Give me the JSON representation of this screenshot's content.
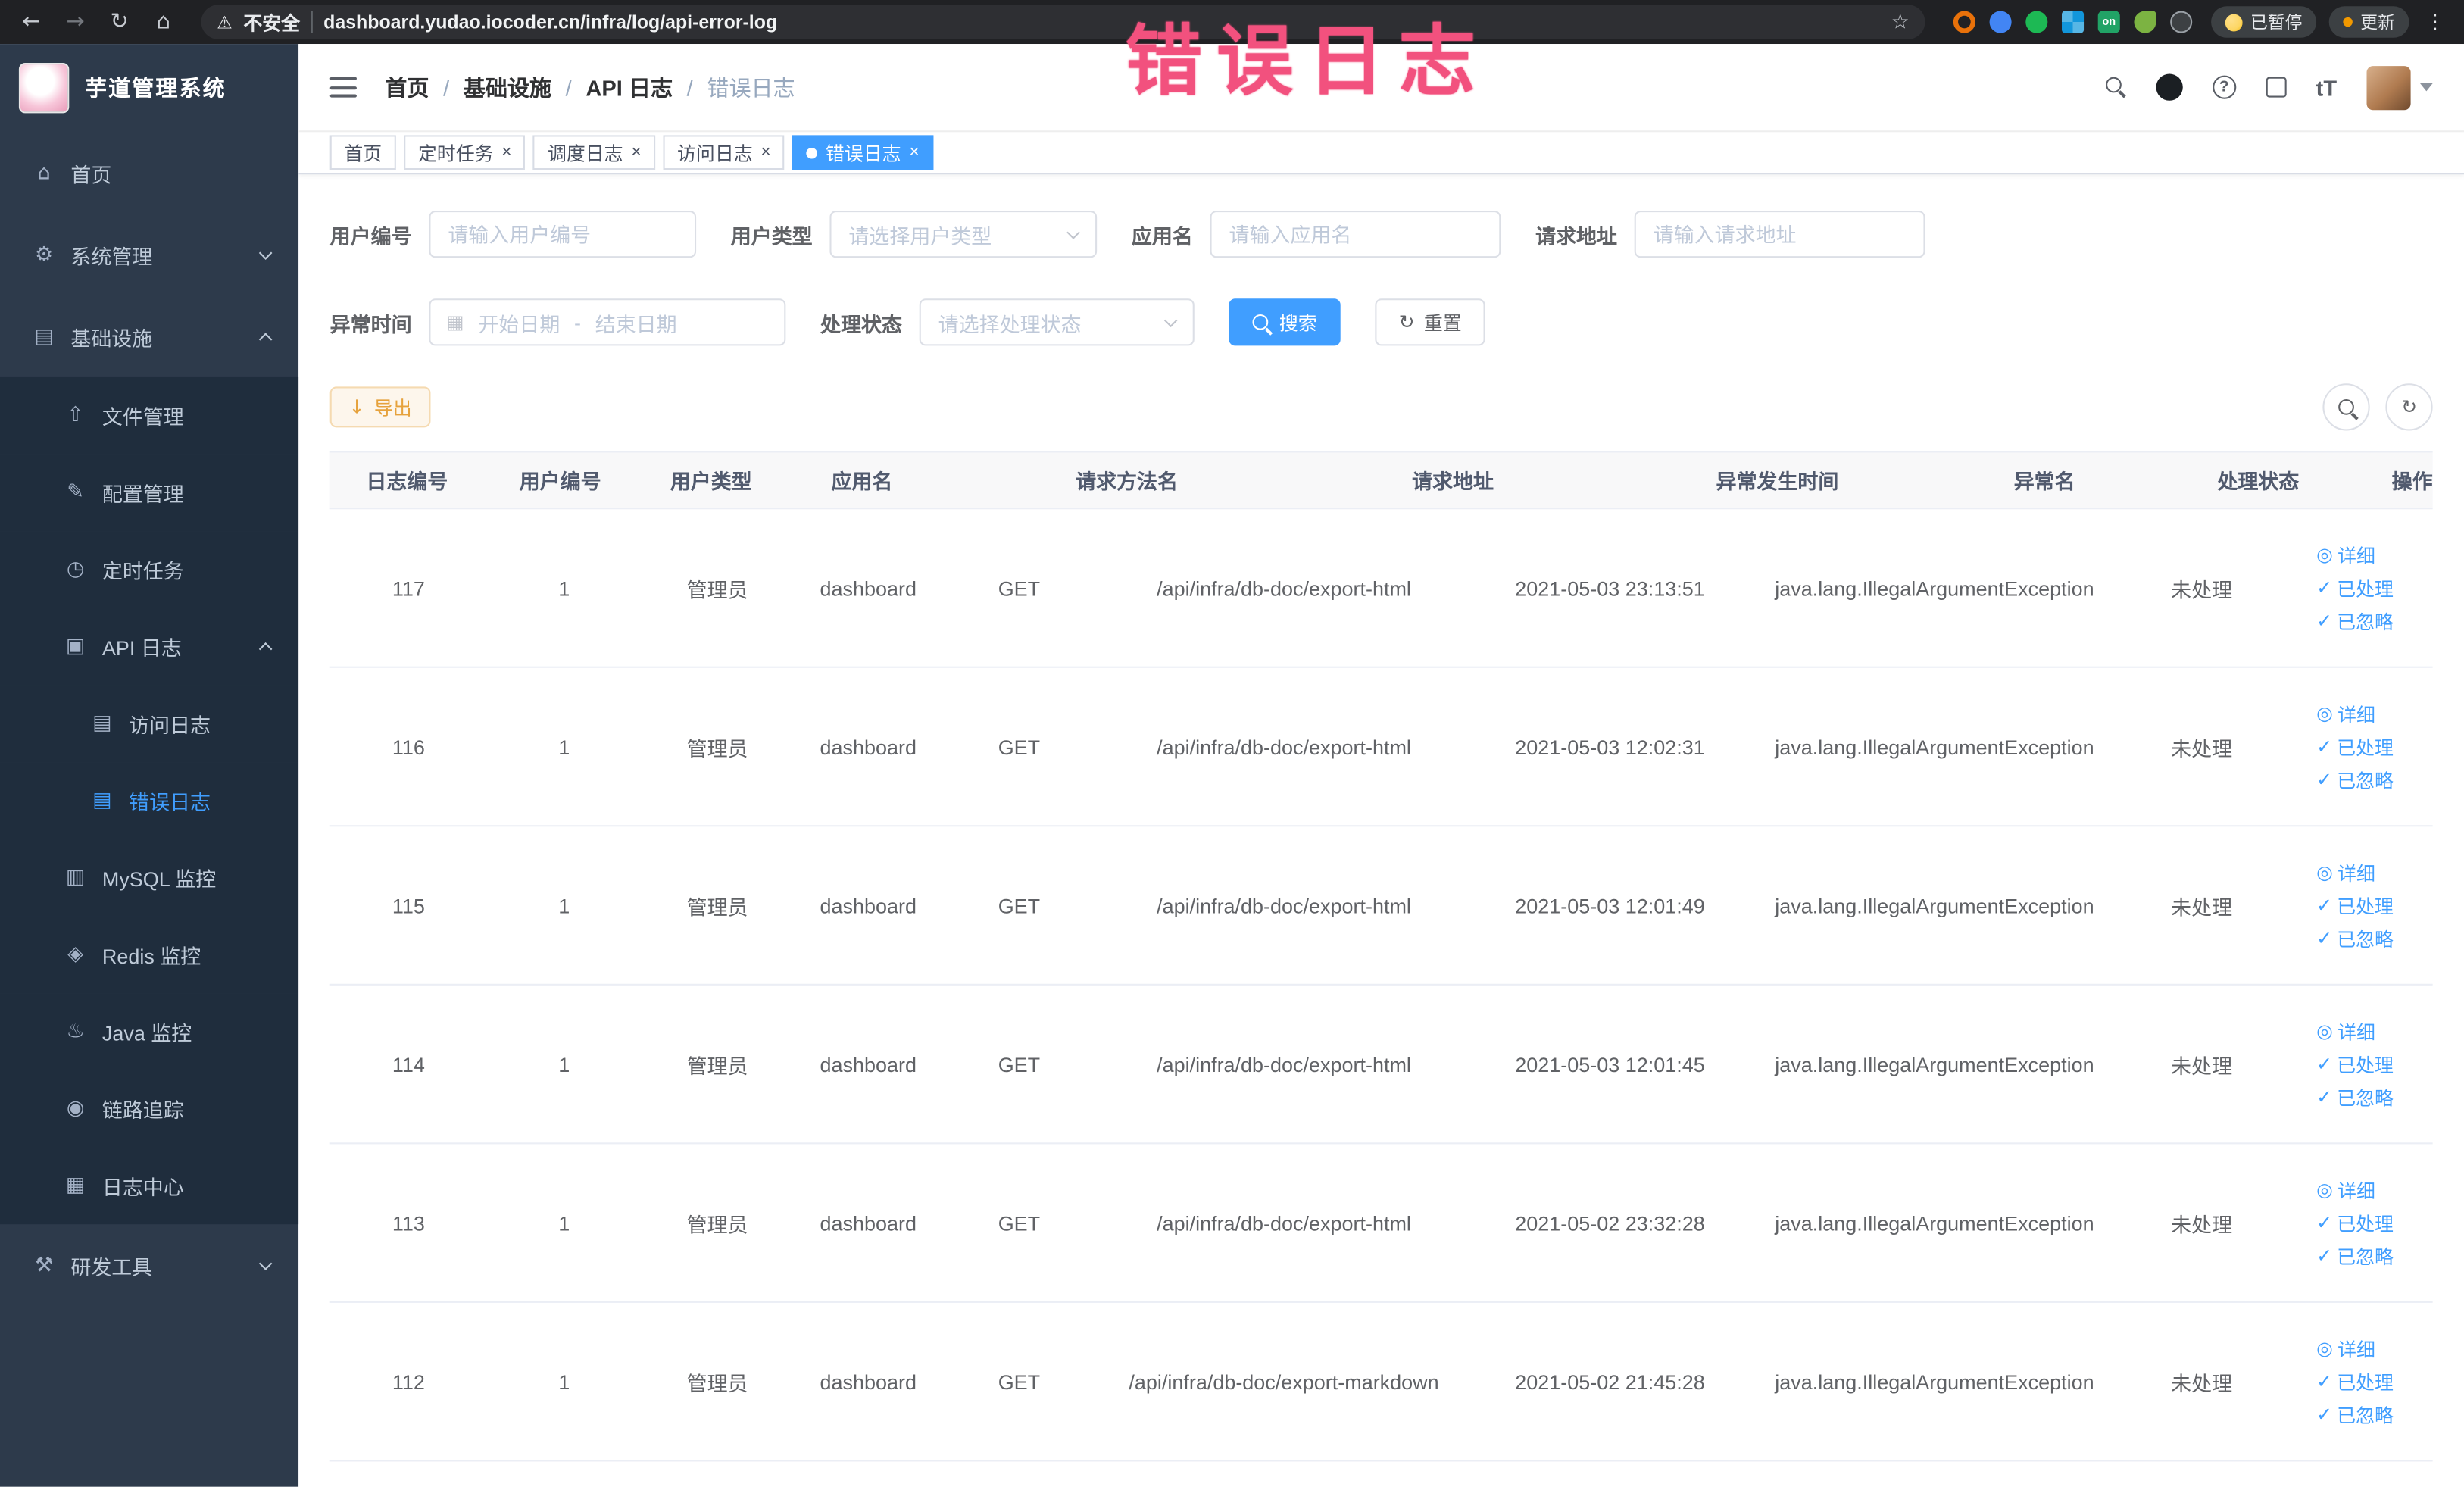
{
  "colors": {
    "accent": "#409EFF",
    "watermark": "#F2517E",
    "warning": "#E6A23C",
    "sidebar_bg": "#2D3A4B",
    "submenu_bg": "#1F2D3D",
    "browser_bar_bg": "#202124"
  },
  "browser": {
    "security_text": "不安全",
    "url": "dashboard.yudao.iocoder.cn/infra/log/api-error-log",
    "paused_label": "已暂停",
    "update_label": "更新",
    "ext_on_label": "on"
  },
  "watermark_text": "错误日志",
  "icons": {
    "back": "←",
    "forward": "→",
    "reload": "↻",
    "home": "⌂",
    "warning": "⚠",
    "star": "☆",
    "dots": "⋮",
    "question": "?",
    "font_size": "tT",
    "calendar": "▦",
    "download": "↓",
    "refresh": "↻",
    "detail": "◎",
    "check": "✓",
    "close": "×"
  },
  "sidebar": {
    "logo_title": "芋道管理系统",
    "items": [
      {
        "label": "首页",
        "icon": "home-icon",
        "glyph": "⌂",
        "level": 1
      },
      {
        "label": "系统管理",
        "icon": "gear-icon",
        "glyph": "⚙",
        "level": 1,
        "arrow": "down"
      },
      {
        "label": "基础设施",
        "icon": "infrastructure-icon",
        "glyph": "▤",
        "level": 1,
        "arrow": "up"
      },
      {
        "label": "文件管理",
        "icon": "file-management-icon",
        "glyph": "⇧",
        "level": 2
      },
      {
        "label": "配置管理",
        "icon": "config-management-icon",
        "glyph": "✎",
        "level": 2
      },
      {
        "label": "定时任务",
        "icon": "scheduled-task-icon",
        "glyph": "◷",
        "level": 2
      },
      {
        "label": "API 日志",
        "icon": "api-log-icon",
        "glyph": "▣",
        "level": 2,
        "arrow": "up"
      },
      {
        "label": "访问日志",
        "icon": "access-log-icon",
        "glyph": "▤",
        "level": 3
      },
      {
        "label": "错误日志",
        "icon": "error-log-icon",
        "glyph": "▤",
        "level": 3,
        "active": "true"
      },
      {
        "label": "MySQL 监控",
        "icon": "mysql-monitor-icon",
        "glyph": "▥",
        "level": 2
      },
      {
        "label": "Redis 监控",
        "icon": "redis-monitor-icon",
        "glyph": "◈",
        "level": 2
      },
      {
        "label": "Java 监控",
        "icon": "java-monitor-icon",
        "glyph": "♨",
        "level": 2
      },
      {
        "label": "链路追踪",
        "icon": "trace-icon",
        "glyph": "◉",
        "level": 2
      },
      {
        "label": "日志中心",
        "icon": "log-center-icon",
        "glyph": "▦",
        "level": 2
      },
      {
        "label": "研发工具",
        "icon": "dev-tools-icon",
        "glyph": "⚒",
        "level": 1,
        "arrow": "down"
      }
    ]
  },
  "header": {
    "breadcrumb": [
      "首页",
      "基础设施",
      "API 日志",
      "错误日志"
    ],
    "separator": "/"
  },
  "tabs": [
    {
      "label": "首页",
      "closable": "false",
      "active": "false"
    },
    {
      "label": "定时任务",
      "closable": "true",
      "active": "false"
    },
    {
      "label": "调度日志",
      "closable": "true",
      "active": "false"
    },
    {
      "label": "访问日志",
      "closable": "true",
      "active": "false"
    },
    {
      "label": "错误日志",
      "closable": "true",
      "active": "true"
    }
  ],
  "filters": {
    "user_id_label": "用户编号",
    "user_id_placeholder": "请输入用户编号",
    "user_type_label": "用户类型",
    "user_type_placeholder": "请选择用户类型",
    "app_name_label": "应用名",
    "app_name_placeholder": "请输入应用名",
    "request_url_label": "请求地址",
    "request_url_placeholder": "请输入请求地址",
    "time_label": "异常时间",
    "time_start_placeholder": "开始日期",
    "time_separator": "-",
    "time_end_placeholder": "结束日期",
    "status_label": "处理状态",
    "status_placeholder": "请选择处理状态",
    "search_button": "搜索",
    "reset_button": "重置"
  },
  "toolbar": {
    "export_button": "导出"
  },
  "actions": {
    "detail": "详细",
    "processed": "已处理",
    "ignored": "已忽略"
  },
  "table": {
    "columns": [
      "日志编号",
      "用户编号",
      "用户类型",
      "应用名",
      "请求方法名",
      "请求地址",
      "异常发生时间",
      "异常名",
      "处理状态",
      "操作"
    ],
    "rows": [
      {
        "id": "117",
        "user_id": "1",
        "user_type": "管理员",
        "app_name": "dashboard",
        "method": "GET",
        "url": "/api/infra/db-doc/export-html",
        "time": "2021-05-03 23:13:51",
        "exception": "java.lang.IllegalArgumentException",
        "status": "未处理"
      },
      {
        "id": "116",
        "user_id": "1",
        "user_type": "管理员",
        "app_name": "dashboard",
        "method": "GET",
        "url": "/api/infra/db-doc/export-html",
        "time": "2021-05-03 12:02:31",
        "exception": "java.lang.IllegalArgumentException",
        "status": "未处理"
      },
      {
        "id": "115",
        "user_id": "1",
        "user_type": "管理员",
        "app_name": "dashboard",
        "method": "GET",
        "url": "/api/infra/db-doc/export-html",
        "time": "2021-05-03 12:01:49",
        "exception": "java.lang.IllegalArgumentException",
        "status": "未处理"
      },
      {
        "id": "114",
        "user_id": "1",
        "user_type": "管理员",
        "app_name": "dashboard",
        "method": "GET",
        "url": "/api/infra/db-doc/export-html",
        "time": "2021-05-03 12:01:45",
        "exception": "java.lang.IllegalArgumentException",
        "status": "未处理"
      },
      {
        "id": "113",
        "user_id": "1",
        "user_type": "管理员",
        "app_name": "dashboard",
        "method": "GET",
        "url": "/api/infra/db-doc/export-html",
        "time": "2021-05-02 23:32:28",
        "exception": "java.lang.IllegalArgumentException",
        "status": "未处理"
      },
      {
        "id": "112",
        "user_id": "1",
        "user_type": "管理员",
        "app_name": "dashboard",
        "method": "GET",
        "url": "/api/infra/db-doc/export-markdown",
        "time": "2021-05-02 21:45:28",
        "exception": "java.lang.IllegalArgumentException",
        "status": "未处理"
      }
    ]
  }
}
